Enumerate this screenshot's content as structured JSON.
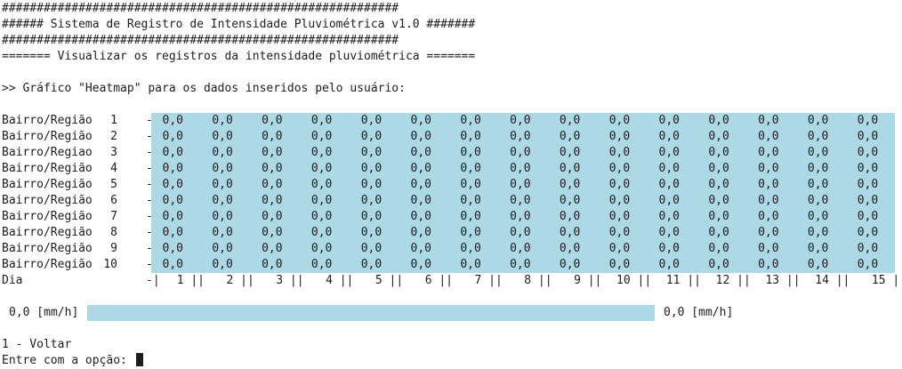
{
  "header": {
    "border_line": "#########################################################",
    "title_line": "###### Sistema de Registro de Intensidade Pluviométrica v1.0 #######",
    "subtitle_line": "======= Visualizar os registros da intensidade pluviométrica ======="
  },
  "chart_intro": ">> Gráfico \"Heatmap\" para os dados inseridos pelo usuário:",
  "chart_data": {
    "type": "heatmap",
    "cell_color": "#add8e6",
    "rows": [
      {
        "name": "Bairro/Região",
        "num": "1",
        "values": [
          "0,0",
          "0,0",
          "0,0",
          "0,0",
          "0,0",
          "0,0",
          "0,0",
          "0,0",
          "0,0",
          "0,0",
          "0,0",
          "0,0",
          "0,0",
          "0,0",
          "0,0"
        ]
      },
      {
        "name": "Bairro/Região",
        "num": "2",
        "values": [
          "0,0",
          "0,0",
          "0,0",
          "0,0",
          "0,0",
          "0,0",
          "0,0",
          "0,0",
          "0,0",
          "0,0",
          "0,0",
          "0,0",
          "0,0",
          "0,0",
          "0,0"
        ]
      },
      {
        "name": "Bairro/Regiao",
        "num": "3",
        "values": [
          "0,0",
          "0,0",
          "0,0",
          "0,0",
          "0,0",
          "0,0",
          "0,0",
          "0,0",
          "0,0",
          "0,0",
          "0,0",
          "0,0",
          "0,0",
          "0,0",
          "0,0"
        ]
      },
      {
        "name": "Bairro/Região",
        "num": "4",
        "values": [
          "0,0",
          "0,0",
          "0,0",
          "0,0",
          "0,0",
          "0,0",
          "0,0",
          "0,0",
          "0,0",
          "0,0",
          "0,0",
          "0,0",
          "0,0",
          "0,0",
          "0,0"
        ]
      },
      {
        "name": "Bairro/Região",
        "num": "5",
        "values": [
          "0,0",
          "0,0",
          "0,0",
          "0,0",
          "0,0",
          "0,0",
          "0,0",
          "0,0",
          "0,0",
          "0,0",
          "0,0",
          "0,0",
          "0,0",
          "0,0",
          "0,0"
        ]
      },
      {
        "name": "Bairro/Região",
        "num": "6",
        "values": [
          "0,0",
          "0,0",
          "0,0",
          "0,0",
          "0,0",
          "0,0",
          "0,0",
          "0,0",
          "0,0",
          "0,0",
          "0,0",
          "0,0",
          "0,0",
          "0,0",
          "0,0"
        ]
      },
      {
        "name": "Bairro/Região",
        "num": "7",
        "values": [
          "0,0",
          "0,0",
          "0,0",
          "0,0",
          "0,0",
          "0,0",
          "0,0",
          "0,0",
          "0,0",
          "0,0",
          "0,0",
          "0,0",
          "0,0",
          "0,0",
          "0,0"
        ]
      },
      {
        "name": "Bairro/Região",
        "num": "8",
        "values": [
          "0,0",
          "0,0",
          "0,0",
          "0,0",
          "0,0",
          "0,0",
          "0,0",
          "0,0",
          "0,0",
          "0,0",
          "0,0",
          "0,0",
          "0,0",
          "0,0",
          "0,0"
        ]
      },
      {
        "name": "Bairro/Região",
        "num": "9",
        "values": [
          "0,0",
          "0,0",
          "0,0",
          "0,0",
          "0,0",
          "0,0",
          "0,0",
          "0,0",
          "0,0",
          "0,0",
          "0,0",
          "0,0",
          "0,0",
          "0,0",
          "0,0"
        ]
      },
      {
        "name": "Bairro/Região",
        "num": "10",
        "values": [
          "0,0",
          "0,0",
          "0,0",
          "0,0",
          "0,0",
          "0,0",
          "0,0",
          "0,0",
          "0,0",
          "0,0",
          "0,0",
          "0,0",
          "0,0",
          "0,0",
          "0,0"
        ]
      }
    ],
    "row_separator": "-",
    "x_axis": {
      "label": "Dia",
      "separator": "-|",
      "days": [
        "1",
        "2",
        "3",
        "4",
        "5",
        "6",
        "7",
        "8",
        "9",
        "10",
        "11",
        "12",
        "13",
        "14",
        "15"
      ]
    },
    "legend": {
      "min_label": "0,0 [mm/h]",
      "max_label": "0,0 [mm/h]"
    }
  },
  "menu": {
    "option_back": "1 - Voltar",
    "prompt": "Entre com a opção:"
  }
}
